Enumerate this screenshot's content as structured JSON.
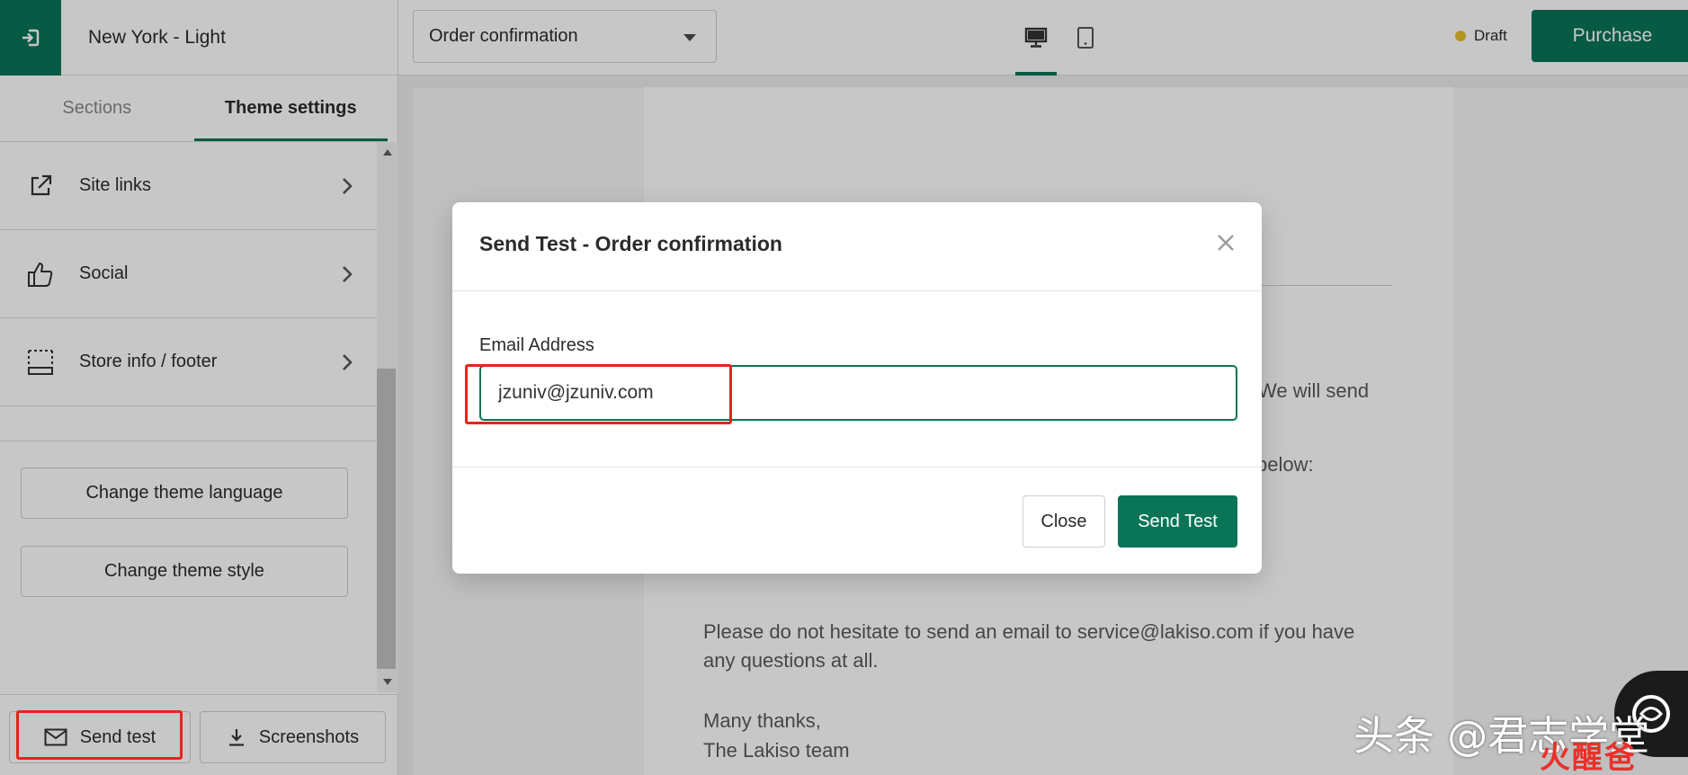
{
  "theme": {
    "name": "New York - Light"
  },
  "tabs": [
    {
      "label": "Sections",
      "active": false
    },
    {
      "label": "Theme settings",
      "active": true
    }
  ],
  "settings_menu": [
    {
      "label": "Site links",
      "icon": "external-link-icon"
    },
    {
      "label": "Social",
      "icon": "thumbs-up-icon"
    },
    {
      "label": "Store info / footer",
      "icon": "footer-layout-icon"
    }
  ],
  "theme_actions": {
    "change_language": "Change theme language",
    "change_style": "Change theme style"
  },
  "bottom_actions": {
    "send_test": "Send test",
    "screenshots": "Screenshots"
  },
  "topbar": {
    "template": "Order confirmation",
    "status": "Draft",
    "status_color": "#e6c12a",
    "purchase": "Purchase",
    "active_device": "desktop"
  },
  "preview": {
    "line_we_will_send": "We will send",
    "line_below": "below:",
    "paragraph_1_line_1": "Please do not hesitate to send an email to service@lakiso.com if you have",
    "paragraph_1_line_2": "any questions at all.",
    "signoff_1": "Many thanks,",
    "signoff_2": "The Lakiso team"
  },
  "modal": {
    "title": "Send Test - Order confirmation",
    "email_label": "Email Address",
    "email_value": "jzuniv@jzuniv.com",
    "close_button": "Close",
    "send_button": "Send Test"
  },
  "watermark": {
    "text": "头条 @君志学堂",
    "brand": "火醒爸"
  },
  "colors": {
    "accent": "#0a7457",
    "highlight": "#e8231b"
  }
}
